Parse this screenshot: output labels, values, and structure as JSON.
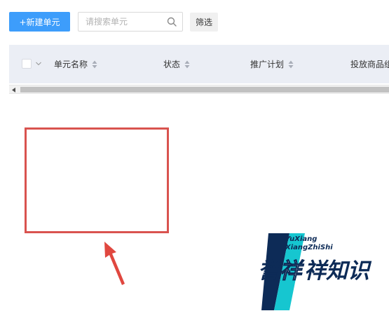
{
  "toolbar": {
    "new_unit_label": "+新建单元",
    "search_placeholder": "请搜索单元",
    "search_value": "",
    "filter_label": "筛选"
  },
  "table": {
    "columns": [
      {
        "label": "单元名称",
        "sortable": true
      },
      {
        "label": "状态",
        "sortable": true
      },
      {
        "label": "推广计划",
        "sortable": true
      },
      {
        "label": "投放商品组",
        "sortable": false
      }
    ],
    "rows": []
  },
  "watermark": {
    "line1": "YuXiang",
    "line2": "XiangZhiShi",
    "char_dark": "誉",
    "char_highlight": "祥",
    "chars_rest": "祥知识"
  },
  "colors": {
    "primary": "#3d9dfb",
    "header_bg": "#ebeef5",
    "annotation": "#d9534f",
    "watermark_navy": "#0d2b57",
    "watermark_teal": "#16c6d0"
  }
}
